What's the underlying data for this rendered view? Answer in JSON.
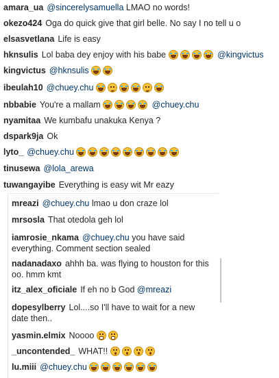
{
  "comments_main": [
    {
      "user": "amara_ua",
      "mention": "@sincerelysamuella",
      "text": "LMAO no words!",
      "emojis": []
    },
    {
      "user": "okezo424",
      "mention": "",
      "text": "Oga do quick give that girl belle. No say I no tell u o",
      "emojis": []
    },
    {
      "user": "elsasvetlana",
      "mention": "",
      "text": "Life is easy",
      "emojis": []
    },
    {
      "user": "hknsulis",
      "mention": "",
      "text": "Lol baba dey enjoy with his babe",
      "emojis": [
        "joy",
        "joy",
        "joy",
        "joy"
      ],
      "trailing_mention": "@kingvictus"
    },
    {
      "user": "kingvictus",
      "mention": "@hknsulis",
      "text": "",
      "emojis": [
        "joy",
        "joy"
      ]
    },
    {
      "user": "ibeulah10",
      "mention": "@chuey.chu",
      "text": "",
      "emojis": [
        "joy",
        "smirk",
        "joy",
        "joy",
        "smirk",
        "joy"
      ]
    },
    {
      "user": "nbbabie",
      "mention": "",
      "text": "You're a mallam",
      "emojis": [
        "joy",
        "joy",
        "joy",
        "joy"
      ],
      "trailing_mention": "@chuey.chu"
    },
    {
      "user": "nyamitaa",
      "mention": "",
      "text": "We kumbafu unakuka Kenya ?",
      "emojis": []
    },
    {
      "user": "dspark9ja",
      "mention": "",
      "text": "Ok",
      "emojis": []
    },
    {
      "user": "lyto_",
      "mention": "@chuey.chu",
      "text": "",
      "emojis": [
        "joy",
        "joy",
        "joy",
        "joy",
        "joy",
        "joy",
        "joy",
        "joy",
        "joy"
      ]
    },
    {
      "user": "tinusewa",
      "mention": "@lola_arewa",
      "text": "",
      "emojis": []
    },
    {
      "user": "tuwangayibe",
      "mention": "",
      "text": "Everything is easy wit Mr eazy",
      "emojis": []
    }
  ],
  "comments_popup": [
    {
      "user": "mreazi",
      "mention": "@chuey.chu",
      "text": "lmao u don craze lol",
      "emojis": []
    },
    {
      "user": "mrsosla",
      "mention": "",
      "text": "That otedola geh lol",
      "emojis": []
    },
    {
      "user": "iamrosie_nkama",
      "mention": "@chuey.chu",
      "text": "you have said everything. Comment section sealed",
      "emojis": []
    },
    {
      "user": "nadanadaxo",
      "mention": "",
      "text": "ahhh ba. was flying to houston for this oo. hmm kmt",
      "emojis": []
    },
    {
      "user": "itz_alex_oficiale",
      "mention": "",
      "text": "If eh no b God",
      "emojis": [],
      "trailing_mention": "@mreazi"
    },
    {
      "user": "dopesylberry",
      "mention": "",
      "text": "Lol....so I'll have to wait for a new date then..",
      "emojis": []
    },
    {
      "user": "yasmin.elmix",
      "mention": "",
      "text": "Noooo",
      "emojis": [
        "grin",
        "grin"
      ]
    },
    {
      "user": "_uncontended_",
      "mention": "",
      "text": "WHAT!!",
      "emojis": [
        "shock",
        "shock",
        "shock",
        "shock"
      ]
    },
    {
      "user": "lu.miii",
      "mention": "@chuey.chu",
      "text": "",
      "emojis": [
        "joy",
        "joy",
        "joy",
        "joy",
        "joy",
        "joy"
      ]
    }
  ]
}
